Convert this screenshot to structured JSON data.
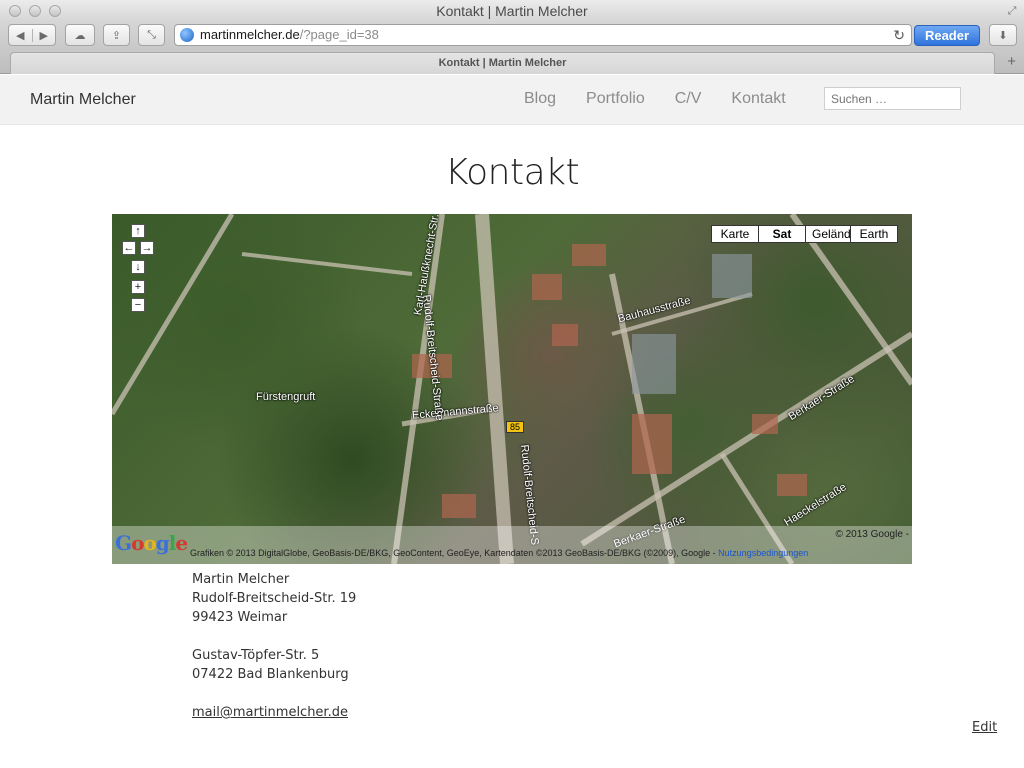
{
  "window": {
    "title": "Kontakt | Martin Melcher"
  },
  "toolbar": {
    "url_host": "martinmelcher.de",
    "url_path": "/?page_id=38",
    "reader_label": "Reader"
  },
  "tab": {
    "label": "Kontakt | Martin Melcher",
    "new_tab": "+"
  },
  "site": {
    "title": "Martin Melcher",
    "nav": [
      "Blog",
      "Portfolio",
      "C/V",
      "Kontakt"
    ],
    "search_placeholder": "Suchen …"
  },
  "page": {
    "title": "Kontakt"
  },
  "map": {
    "types": [
      "Karte",
      "Sat",
      "Gelände",
      "Earth"
    ],
    "active_type": "Sat",
    "labels": {
      "fuerstengruft": "Fürstengruft",
      "eckermann": "Eckermannstraße",
      "rudolf1": "Rudolf-Breitscheid-Straße",
      "rudolf2": "Rudolf-Breitscheid-S",
      "karl": "Karl-Haußknecht-Str.",
      "bauhaus": "Bauhausstraße",
      "berkaer": "Berkaer-Straße",
      "haeckel": "Haeckelstraße",
      "berkaer2": "Berkaer-Straße",
      "route": "85"
    },
    "copyright": "© 2013 Google -",
    "attribution": "Grafiken © 2013 DigitalGlobe, GeoBasis-DE/BKG, GeoContent, GeoEye, Kartendaten ©2013 GeoBasis-DE/BKG (©2009), Google - ",
    "terms_link": "Nutzungsbedingungen",
    "logo": [
      "G",
      "o",
      "o",
      "g",
      "l",
      "e"
    ]
  },
  "address": {
    "name": "Martin Melcher",
    "street1": "Rudolf-Breitscheid-Str. 19",
    "city1": "99423 Weimar",
    "street2": "Gustav-Töpfer-Str. 5",
    "city2": "07422 Bad Blankenburg",
    "email": "mail@martinmelcher.de"
  },
  "edit_label": "Edit"
}
